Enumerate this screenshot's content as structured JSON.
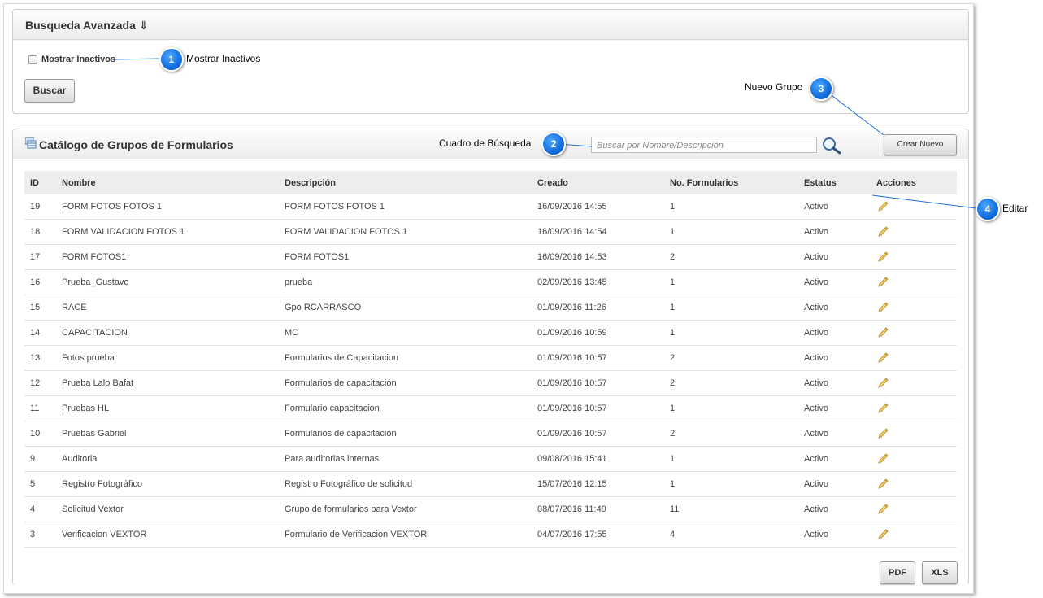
{
  "search_panel": {
    "title": "Busqueda Avanzada ⇓",
    "checkbox_label": "Mostrar Inactivos",
    "search_button": "Buscar"
  },
  "catalog_panel": {
    "title": "Catálogo de Grupos de Formularios",
    "search_placeholder": "Buscar por Nombre/Descripción",
    "new_button": "Crear Nuevo",
    "pdf_button": "PDF",
    "xls_button": "XLS"
  },
  "table": {
    "headers": [
      "ID",
      "Nombre",
      "Descripción",
      "Creado",
      "No. Formularios",
      "Estatus",
      "Acciones"
    ],
    "rows": [
      {
        "id": "19",
        "nombre": "FORM FOTOS FOTOS 1",
        "descripcion": "FORM FOTOS FOTOS 1",
        "creado": "16/09/2016 14:55",
        "formularios": "1",
        "estatus": "Activo"
      },
      {
        "id": "18",
        "nombre": "FORM VALIDACION FOTOS 1",
        "descripcion": "FORM VALIDACION FOTOS 1",
        "creado": "16/09/2016 14:54",
        "formularios": "1",
        "estatus": "Activo"
      },
      {
        "id": "17",
        "nombre": "FORM FOTOS1",
        "descripcion": "FORM FOTOS1",
        "creado": "16/09/2016 14:53",
        "formularios": "2",
        "estatus": "Activo"
      },
      {
        "id": "16",
        "nombre": "Prueba_Gustavo",
        "descripcion": "prueba",
        "creado": "02/09/2016 13:45",
        "formularios": "1",
        "estatus": "Activo"
      },
      {
        "id": "15",
        "nombre": "RACE",
        "descripcion": "Gpo RCARRASCO",
        "creado": "01/09/2016 11:26",
        "formularios": "1",
        "estatus": "Activo"
      },
      {
        "id": "14",
        "nombre": "CAPACITACION",
        "descripcion": "MC",
        "creado": "01/09/2016 10:59",
        "formularios": "1",
        "estatus": "Activo"
      },
      {
        "id": "13",
        "nombre": "Fotos prueba",
        "descripcion": "Formularios de Capacitacion",
        "creado": "01/09/2016 10:57",
        "formularios": "2",
        "estatus": "Activo"
      },
      {
        "id": "12",
        "nombre": "Prueba Lalo Bafat",
        "descripcion": "Formularios de capacitación",
        "creado": "01/09/2016 10:57",
        "formularios": "2",
        "estatus": "Activo"
      },
      {
        "id": "11",
        "nombre": "Pruebas HL",
        "descripcion": "Formulario capacitacion",
        "creado": "01/09/2016 10:57",
        "formularios": "1",
        "estatus": "Activo"
      },
      {
        "id": "10",
        "nombre": "Pruebas Gabriel",
        "descripcion": "Formularios de capacitacion",
        "creado": "01/09/2016 10:57",
        "formularios": "2",
        "estatus": "Activo"
      },
      {
        "id": "9",
        "nombre": "Auditoria",
        "descripcion": "Para auditorias internas",
        "creado": "09/08/2016 15:41",
        "formularios": "1",
        "estatus": "Activo"
      },
      {
        "id": "5",
        "nombre": "Registro Fotográfico",
        "descripcion": "Registro Fotográfico de solicitud",
        "creado": "15/07/2016 12:15",
        "formularios": "1",
        "estatus": "Activo"
      },
      {
        "id": "4",
        "nombre": "Solicitud Vextor",
        "descripcion": "Grupo de formularios para Vextor",
        "creado": "08/07/2016 11:49",
        "formularios": "11",
        "estatus": "Activo"
      },
      {
        "id": "3",
        "nombre": "Verificacion VEXTOR",
        "descripcion": "Formulario de Verificacion VEXTOR",
        "creado": "04/07/2016 17:55",
        "formularios": "4",
        "estatus": "Activo"
      }
    ]
  },
  "callouts": [
    {
      "number": "1",
      "label": "Mostrar Inactivos"
    },
    {
      "number": "2",
      "label": "Cuadro de Búsqueda"
    },
    {
      "number": "3",
      "label": "Nuevo Grupo"
    },
    {
      "number": "4",
      "label": "Editar"
    }
  ],
  "icons": {
    "checkbox": "checkbox-icon",
    "catalog": "grid-icon",
    "search": "magnifier-icon",
    "edit": "pencil-icon"
  },
  "colors": {
    "callout": "#0a63d6",
    "header_bg": "#ededed",
    "pencil": "#e0b84a"
  }
}
